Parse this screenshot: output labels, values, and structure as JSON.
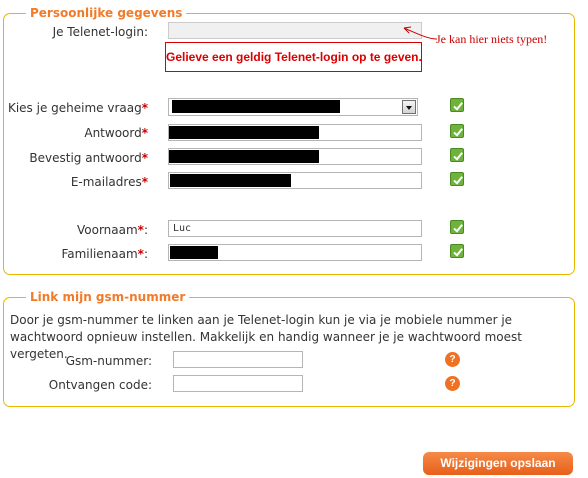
{
  "section_personal": {
    "legend": "Persoonlijke gegevens",
    "telenet_login_label": "Je Telenet-login:",
    "error_message": "Gelieve een geldig Telenet-login op te geven.",
    "annotation": "Je kan hier niets typen!",
    "secret_question_label": "Kies je geheime vraag",
    "answer_label": "Antwoord",
    "confirm_answer_label": "Bevestig antwoord",
    "email_label": "E-mailadres",
    "first_name_label": "Voornaam",
    "first_name_value": "Luc",
    "last_name_label": "Familienaam",
    "required_marker": "*",
    "label_suffix": ":"
  },
  "section_gsm": {
    "legend": "Link mijn gsm-nummer",
    "description": "Door je gsm-nummer te linken aan je Telenet-login kun je via je mobiele nummer je wachtwoord opnieuw instellen. Makkelijk en handig wanneer je je wachtwoord moest vergeten.",
    "gsm_label": "Gsm-nummer:",
    "code_label": "Ontvangen code:",
    "help_glyph": "?"
  },
  "save_button": {
    "label": "Wijzigingen opslaan"
  },
  "colors": {
    "accent": "#f07b2a",
    "border": "#e8b800",
    "error": "#d80000",
    "valid": "#6fb33c"
  },
  "icons": {
    "valid": "checkmark-icon",
    "help": "help-icon",
    "dropdown": "chevron-down-icon"
  }
}
